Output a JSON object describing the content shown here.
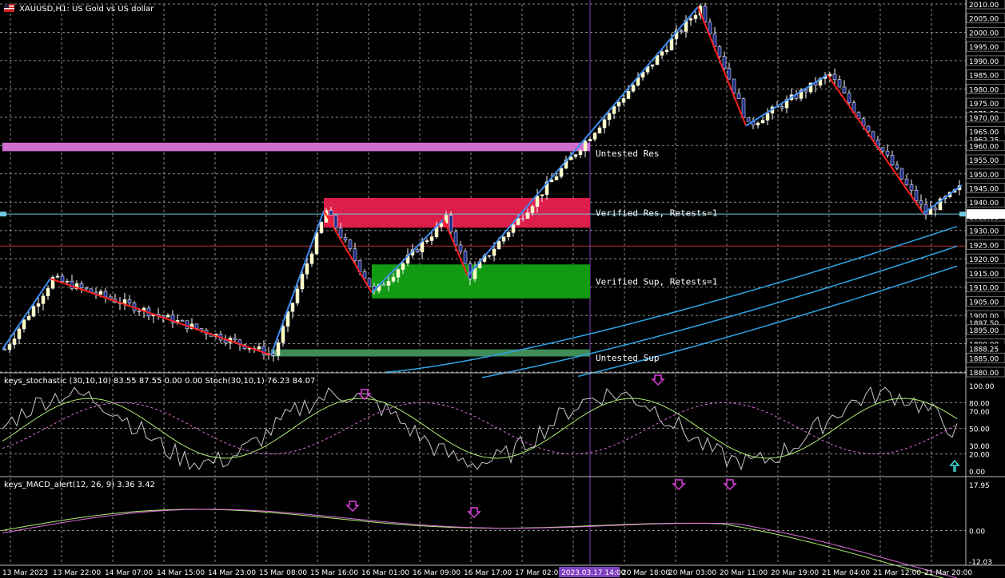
{
  "colors": {
    "background": "#000000",
    "grid": "#8a8a8a",
    "bull_candle": "#ffffc0",
    "bear_candle": "#1d2b8c",
    "zigzag_up": "#3f8cf0",
    "zigzag_down": "#ff1f1f",
    "ma": "#2fa4e7",
    "support_zone": "#139a13",
    "support_zone_weak": "#3f8c5a",
    "resistance_zone": "#dc1e4a",
    "resistance_zone_weak": "#d06ed0",
    "stoch_main": "#c8c8c8",
    "stoch_signal": "#b2f072",
    "stoch_slow": "#e070e0",
    "macd_main": "#b2f072",
    "macd_signal": "#e070e0",
    "arrow": "#e040e0",
    "arrow_up": "#40e0e0",
    "current_price_line": "#6ec8e0",
    "time_highlight": "#8040c0"
  },
  "icons": {
    "flag": "flag-icon"
  },
  "main_panel": {
    "title": "XAUUSD,H1: US Gold vs US dollar",
    "price_labels": [
      "2010.00",
      "2005.00",
      "2000.00",
      "1995.00",
      "1990.00",
      "1985.00",
      "1980.00",
      "1975.00",
      "1971.50",
      "1970.00",
      "1965.00",
      "1962.25",
      "1960.00",
      "1955.00",
      "1950.00",
      "1945.00",
      "1940.00",
      "1935.00",
      "1930.00",
      "1925.00",
      "1920.00",
      "1915.00",
      "1910.00",
      "1905.75",
      "1905.00",
      "1900.00",
      "1897.50",
      "1895.00",
      "1890.00",
      "1888.25",
      "1885.00",
      "1880.00"
    ],
    "zones": [
      {
        "label": "Untested Res"
      },
      {
        "label": "Verified Res, Retests=1"
      },
      {
        "label": "Verified Sup, Retests=1"
      },
      {
        "label": "Untested Sup"
      }
    ]
  },
  "stoch_panel": {
    "title": "keys_stochastic (30,10,10) 83.55 87.55 0.00 0.00 Stoch(30,10,1) 76.23 84.07",
    "levels": [
      "100.00",
      "80.00",
      "70.00",
      "50.00",
      "30.00",
      "20.00",
      "0.00"
    ]
  },
  "macd_panel": {
    "title": "keys_MACD_alert(12, 26, 9) 3.36 3.42",
    "levels": [
      "17.95",
      "0.00",
      "-12.03"
    ]
  },
  "time_axis": {
    "labels": [
      "13 Mar 2023",
      "13 Mar 22:00",
      "14 Mar 07:00",
      "14 Mar 15:00",
      "14 Mar 23:00",
      "15 Mar 08:00",
      "15 Mar 16:00",
      "16 Mar 01:00",
      "16 Mar 09:00",
      "16 Mar 17:00",
      "17 Mar 02:00",
      "2023.03.17 14:00",
      "20 Mar 18:00",
      "20 Mar 03:00",
      "20 Mar 11:00",
      "20 Mar 19:00",
      "21 Mar 04:00",
      "21 Mar 12:00",
      "21 Mar 20:00"
    ],
    "highlight_index": 11
  },
  "chart_data": {
    "type": "candlestick",
    "title": "XAUUSD,H1: US Gold vs US dollar",
    "ylim": [
      1880,
      2010
    ],
    "bars": 190,
    "zigzag": [
      {
        "bar": 0,
        "price": 1888
      },
      {
        "bar": 10,
        "price": 1913
      },
      {
        "bar": 56,
        "price": 1886
      },
      {
        "bar": 67,
        "price": 1937
      },
      {
        "bar": 77,
        "price": 1908
      },
      {
        "bar": 92,
        "price": 1934
      },
      {
        "bar": 97,
        "price": 1914
      },
      {
        "bar": 145,
        "price": 2009
      },
      {
        "bar": 155,
        "price": 1967
      },
      {
        "bar": 172,
        "price": 1985
      },
      {
        "bar": 192,
        "price": 1936
      },
      {
        "bar": 200,
        "price": 1946
      }
    ],
    "zones": [
      {
        "label": "Untested Res",
        "from": 1958,
        "to": 1961,
        "start_bar": 0
      },
      {
        "label": "Verified Res, Retests=1",
        "from": 1931,
        "to": 1941.5,
        "start_bar": 67
      },
      {
        "label": "Verified Sup, Retests=1",
        "from": 1906,
        "to": 1918,
        "start_bar": 77
      },
      {
        "label": "Untested Sup",
        "from": 1885.5,
        "to": 1888,
        "start_bar": 56
      }
    ],
    "current_price": 1935.8,
    "stochastic": {
      "main": 76.23,
      "signal": 84.07,
      "ylim": [
        0,
        100
      ]
    },
    "macd": {
      "main": 3.36,
      "signal": 3.42,
      "ylim": [
        -12.03,
        17.95
      ]
    }
  }
}
